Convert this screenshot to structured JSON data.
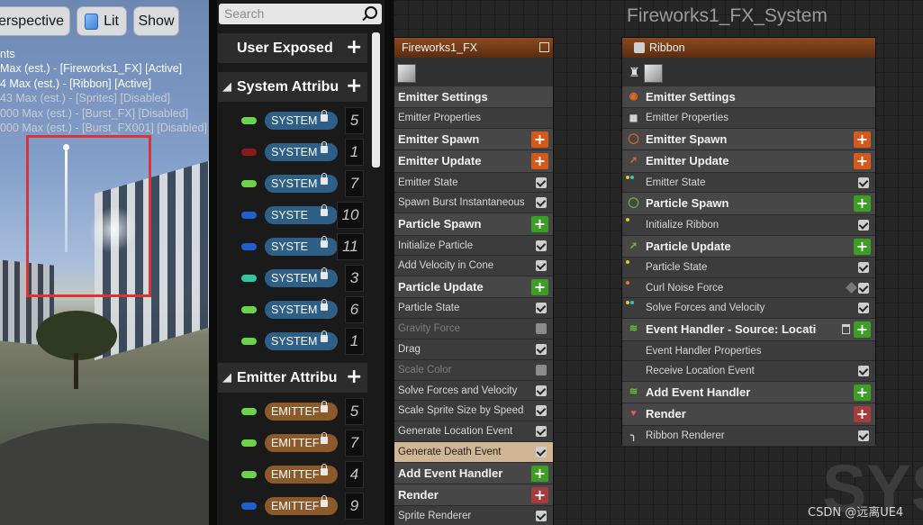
{
  "viewport": {
    "perspective_label": "erspective",
    "lit_label": "Lit",
    "show_label": "Show",
    "stats": [
      {
        "text": "nts",
        "state": "active"
      },
      {
        "text": "Max (est.) - [Fireworks1_FX] [Active]",
        "state": "active"
      },
      {
        "text": "4 Max (est.) - [Ribbon] [Active]",
        "state": "active"
      },
      {
        "text": "43 Max (est.) - [Sprites] [Disabled]",
        "state": "disabled"
      },
      {
        "text": "000 Max (est.) - [Burst_FX] [Disabled]",
        "state": "disabled"
      },
      {
        "text": "000 Max (est.) - [Burst_FX001] [Disabled]",
        "state": "disabled"
      }
    ]
  },
  "params": {
    "search_placeholder": "Search",
    "headers": [
      "User Exposed",
      "System Attribu",
      "Emitter Attribu"
    ],
    "system_rows": [
      {
        "label": "SYSTEM",
        "value": "5",
        "color": "#6bd34a"
      },
      {
        "label": "SYSTEM",
        "value": "1",
        "color": "#8b1a1a"
      },
      {
        "label": "SYSTEM",
        "value": "7",
        "color": "#6bd34a"
      },
      {
        "label": "SYSTE",
        "value": "10",
        "color": "#1f5fd0"
      },
      {
        "label": "SYSTE",
        "value": "11",
        "color": "#1f5fd0"
      },
      {
        "label": "SYSTEM",
        "value": "3",
        "color": "#2ec7a0"
      },
      {
        "label": "SYSTEM",
        "value": "6",
        "color": "#6bd34a"
      },
      {
        "label": "SYSTEM",
        "value": "1",
        "color": "#6bd34a"
      }
    ],
    "emitter_rows": [
      {
        "label": "EMITTEF",
        "value": "5",
        "color": "#6bd34a"
      },
      {
        "label": "EMITTEF",
        "value": "7",
        "color": "#6bd34a"
      },
      {
        "label": "EMITTEF",
        "value": "4",
        "color": "#6bd34a"
      },
      {
        "label": "EMITTEF",
        "value": "9",
        "color": "#1f5fd0"
      }
    ]
  },
  "graph": {
    "title": "Fireworks1_FX_System",
    "watermark": "SYS",
    "credit": "CSDN @远离UE4"
  },
  "node_left": {
    "title": "Fireworks1_FX",
    "rows": [
      {
        "type": "group",
        "label": "Emitter Settings"
      },
      {
        "type": "mod",
        "label": "Emitter Properties"
      },
      {
        "type": "group",
        "label": "Emitter Spawn",
        "add": "orange"
      },
      {
        "type": "group",
        "label": "Emitter Update",
        "add": "orange"
      },
      {
        "type": "mod",
        "label": "Emitter State",
        "check": true
      },
      {
        "type": "mod",
        "label": "Spawn Burst Instantaneous",
        "check": true
      },
      {
        "type": "group",
        "label": "Particle Spawn",
        "add": "green"
      },
      {
        "type": "mod",
        "label": "Initialize Particle",
        "check": true
      },
      {
        "type": "mod",
        "label": "Add Velocity in Cone",
        "check": true
      },
      {
        "type": "group",
        "label": "Particle Update",
        "add": "green"
      },
      {
        "type": "mod",
        "label": "Particle State",
        "check": true
      },
      {
        "type": "mod",
        "label": "Gravity Force",
        "check": false,
        "dim": true
      },
      {
        "type": "mod",
        "label": "Drag",
        "check": true
      },
      {
        "type": "mod",
        "label": "Scale Color",
        "check": false,
        "dim": true
      },
      {
        "type": "mod",
        "label": "Solve Forces and Velocity",
        "check": true
      },
      {
        "type": "mod",
        "label": "Scale Sprite Size by Speed",
        "check": true
      },
      {
        "type": "mod",
        "label": "Generate Location Event",
        "check": true
      },
      {
        "type": "mod",
        "label": "Generate Death Event",
        "check": true,
        "hl": true
      },
      {
        "type": "group",
        "label": "Add Event Handler",
        "add": "green"
      },
      {
        "type": "group",
        "label": "Render",
        "add": "red"
      },
      {
        "type": "mod",
        "label": "Sprite Renderer",
        "check": true
      }
    ]
  },
  "node_right": {
    "title": "Ribbon",
    "rows": [
      {
        "type": "group",
        "label": "Emitter Settings",
        "icon": "emitter-settings-icon",
        "icon_color": "#e0692a"
      },
      {
        "type": "mod",
        "label": "Emitter Properties",
        "icon": "cpu-icon"
      },
      {
        "type": "group",
        "label": "Emitter Spawn",
        "add": "orange",
        "icon": "emitter-spawn-icon",
        "icon_color": "#e0692a"
      },
      {
        "type": "group",
        "label": "Emitter Update",
        "add": "orange",
        "icon": "emitter-update-icon",
        "icon_color": "#e0692a"
      },
      {
        "type": "mod",
        "label": "Emitter State",
        "check": true,
        "icon": "dots-icon"
      },
      {
        "type": "group",
        "label": "Particle Spawn",
        "add": "green",
        "icon": "particle-spawn-icon",
        "icon_color": "#5cc43a"
      },
      {
        "type": "mod",
        "label": "Initialize Ribbon",
        "check": true,
        "icon": "dot-icon",
        "dot_color": "#e8c52a"
      },
      {
        "type": "group",
        "label": "Particle Update",
        "add": "green",
        "icon": "particle-update-icon",
        "icon_color": "#5cc43a"
      },
      {
        "type": "mod",
        "label": "Particle State",
        "check": true,
        "icon": "dot-icon",
        "dot_color": "#e8c52a"
      },
      {
        "type": "mod",
        "label": "Curl Noise Force",
        "check": true,
        "icon": "dot-icon",
        "dot_color": "#e07a2a",
        "cube": true
      },
      {
        "type": "mod",
        "label": "Solve Forces and Velocity",
        "check": true,
        "icon": "dots-icon"
      },
      {
        "type": "group",
        "label": "Event Handler - Source: LocationEv",
        "add": "green",
        "icon": "event-handler-icon",
        "icon_color": "#5cc43a",
        "trash": true
      },
      {
        "type": "mod",
        "label": "Event Handler Properties"
      },
      {
        "type": "mod",
        "label": "Receive Location Event",
        "check": true
      },
      {
        "type": "group",
        "label": "Add Event Handler",
        "add": "green",
        "icon": "add-event-handler-icon",
        "icon_color": "#5cc43a"
      },
      {
        "type": "group",
        "label": "Render",
        "add": "red",
        "icon": "render-icon",
        "icon_color": "#d65a5a"
      },
      {
        "type": "mod",
        "label": "Ribbon Renderer",
        "check": true,
        "icon": "ribbon-icon"
      }
    ]
  }
}
